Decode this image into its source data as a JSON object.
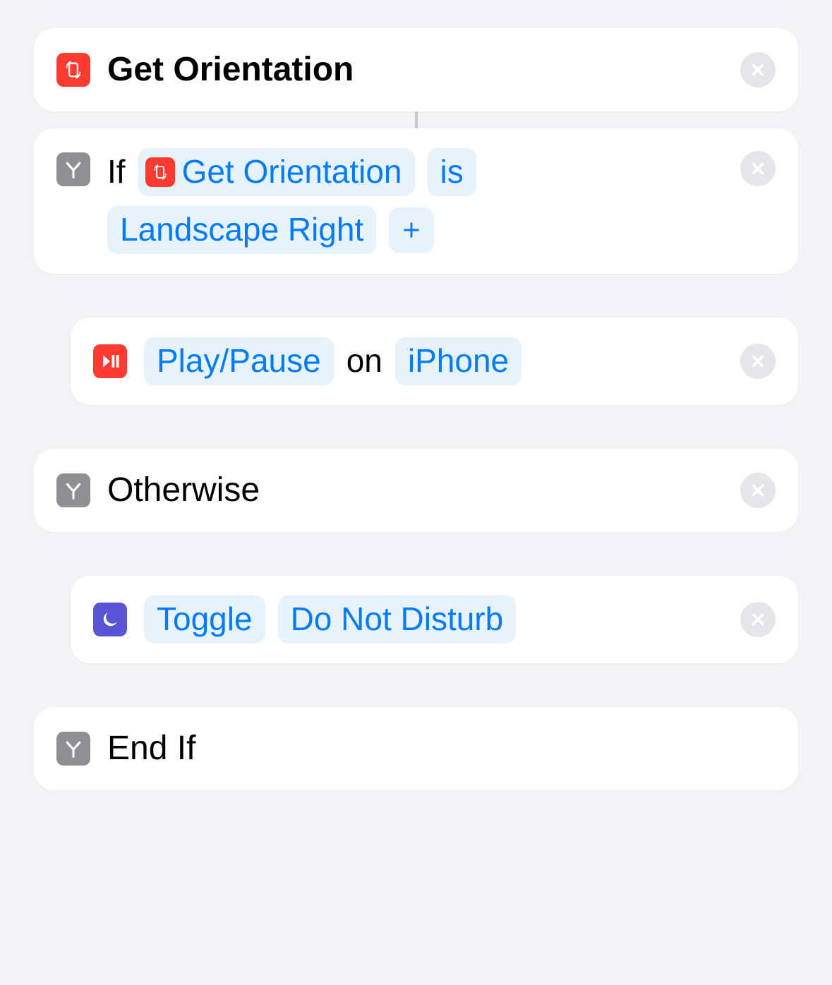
{
  "actions": {
    "getOrientation": {
      "title": "Get Orientation"
    },
    "ifBlock": {
      "keyword": "If",
      "variableLabel": "Get Orientation",
      "operator": "is",
      "value": "Landscape Right"
    },
    "playPause": {
      "mode": "Play/Pause",
      "connector": "on",
      "device": "iPhone"
    },
    "otherwise": {
      "label": "Otherwise"
    },
    "dnd": {
      "mode": "Toggle",
      "focus": "Do Not Disturb"
    },
    "endIf": {
      "label": "End If"
    }
  }
}
